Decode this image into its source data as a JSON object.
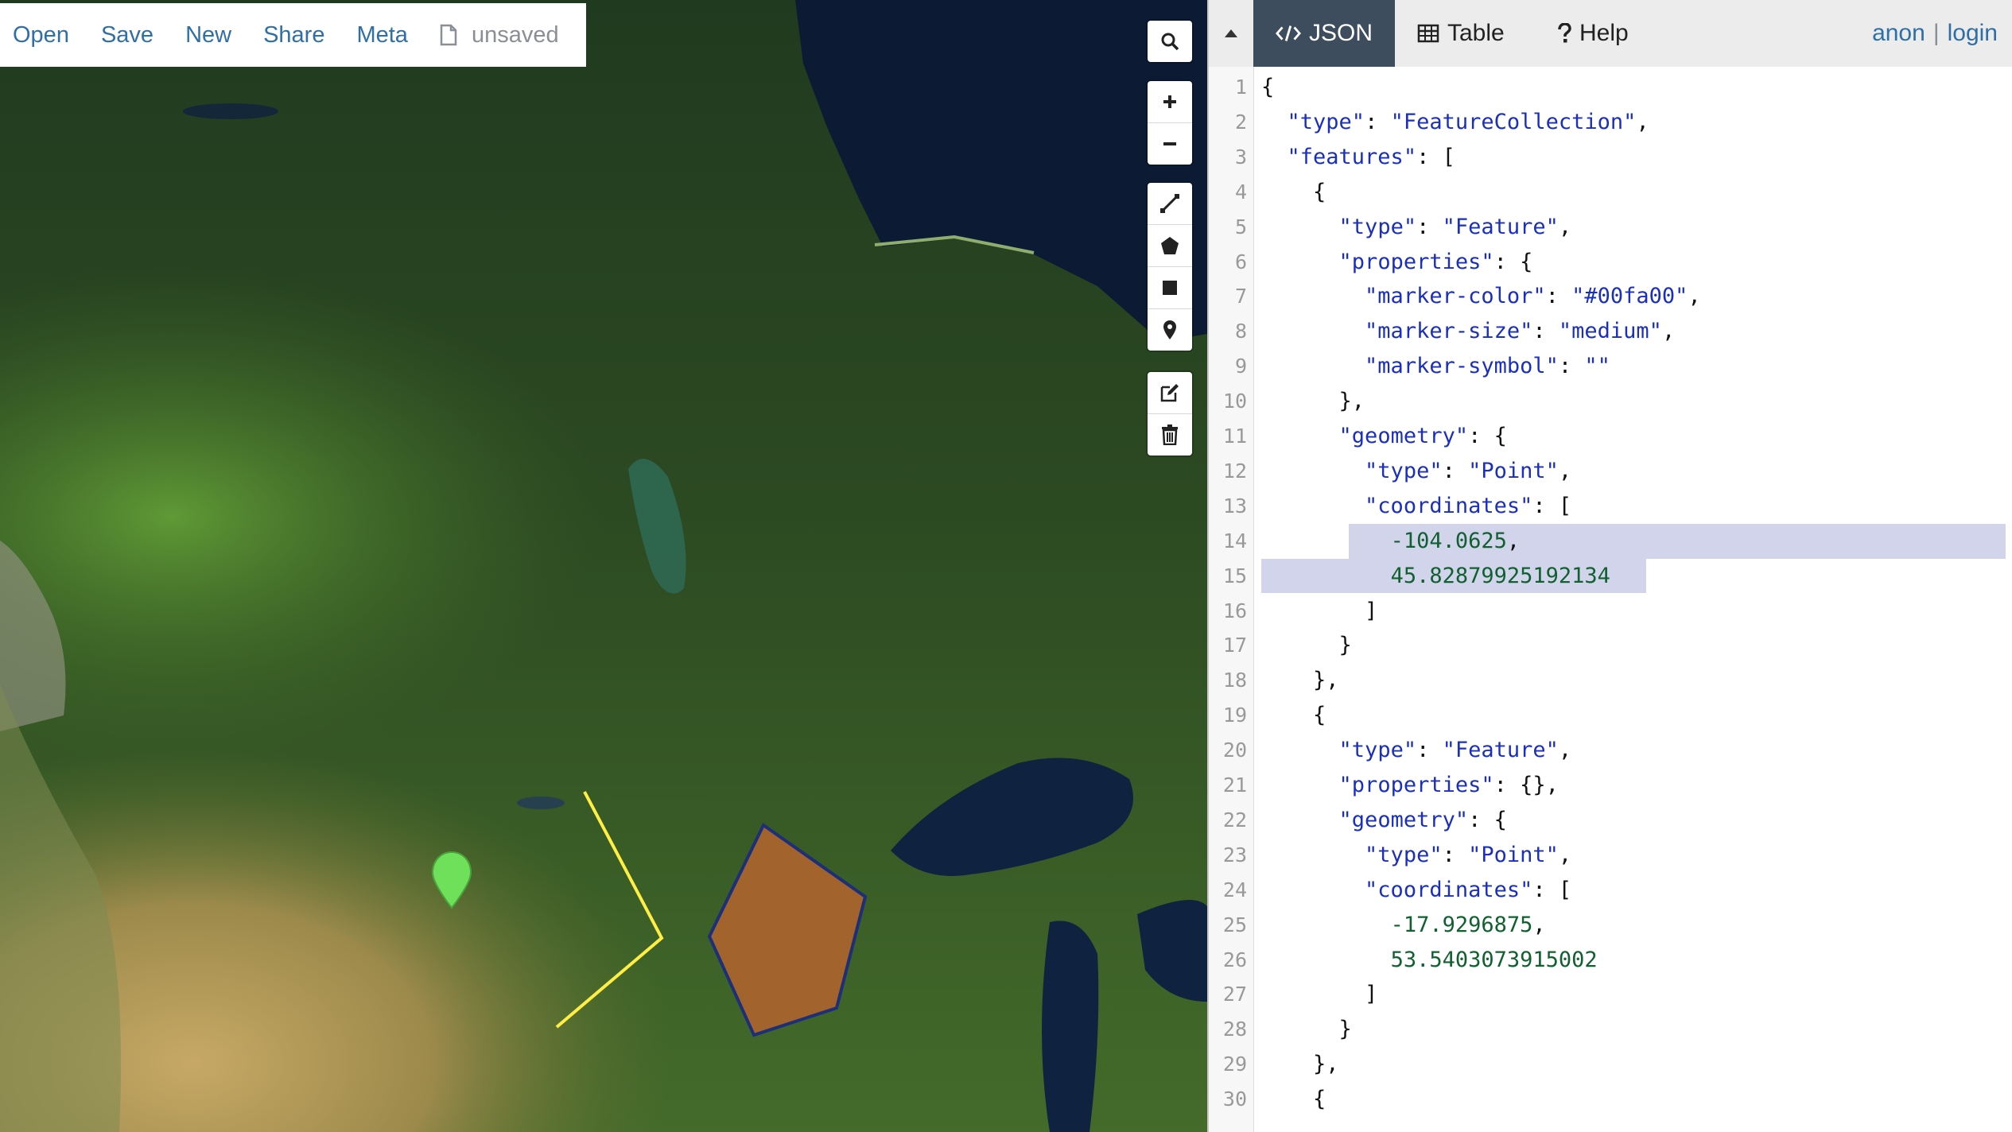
{
  "menu": {
    "items": [
      "Open",
      "Save",
      "New",
      "Share",
      "Meta"
    ],
    "status": "unsaved",
    "status_icon": "document-icon"
  },
  "map_controls": {
    "search_icon": "search-icon",
    "zoom": [
      "zoom-in-icon",
      "zoom-out-icon"
    ],
    "draw": [
      "draw-line-icon",
      "draw-polygon-icon",
      "draw-rectangle-icon",
      "draw-marker-icon"
    ],
    "edit": [
      "edit-icon",
      "delete-icon"
    ]
  },
  "map": {
    "marker_color": "#6fe05a",
    "line_color": "#ffee44",
    "polygon_fill": "#a8642c",
    "polygon_stroke": "#1e2f7a"
  },
  "panel": {
    "tabs": [
      {
        "label": "JSON",
        "icon": "code-icon",
        "active": true
      },
      {
        "label": "Table",
        "icon": "table-icon",
        "active": false
      },
      {
        "label": "Help",
        "icon": "help-icon",
        "active": false
      }
    ],
    "user": {
      "anon": "anon",
      "separator": "|",
      "login": "login"
    }
  },
  "editor": {
    "line_numbers": [
      "1",
      "2",
      "3",
      "4",
      "5",
      "6",
      "7",
      "8",
      "9",
      "10",
      "11",
      "12",
      "13",
      "14",
      "15",
      "16",
      "17",
      "18",
      "19",
      "20",
      "21",
      "22",
      "23",
      "24",
      "25",
      "26",
      "27",
      "28",
      "29",
      "30"
    ],
    "lines": [
      "{",
      "  \"type\": \"FeatureCollection\",",
      "  \"features\": [",
      "    {",
      "      \"type\": \"Feature\",",
      "      \"properties\": {",
      "        \"marker-color\": \"#00fa00\",",
      "        \"marker-size\": \"medium\",",
      "        \"marker-symbol\": \"\"",
      "      },",
      "      \"geometry\": {",
      "        \"type\": \"Point\",",
      "        \"coordinates\": [",
      "          -104.0625,",
      "          45.82879925192134",
      "        ]",
      "      }",
      "    },",
      "    {",
      "      \"type\": \"Feature\",",
      "      \"properties\": {},",
      "      \"geometry\": {",
      "        \"type\": \"Point\",",
      "        \"coordinates\": [",
      "          -17.9296875,",
      "          53.5403073915002",
      "        ]",
      "      }",
      "    },",
      "    {"
    ]
  }
}
